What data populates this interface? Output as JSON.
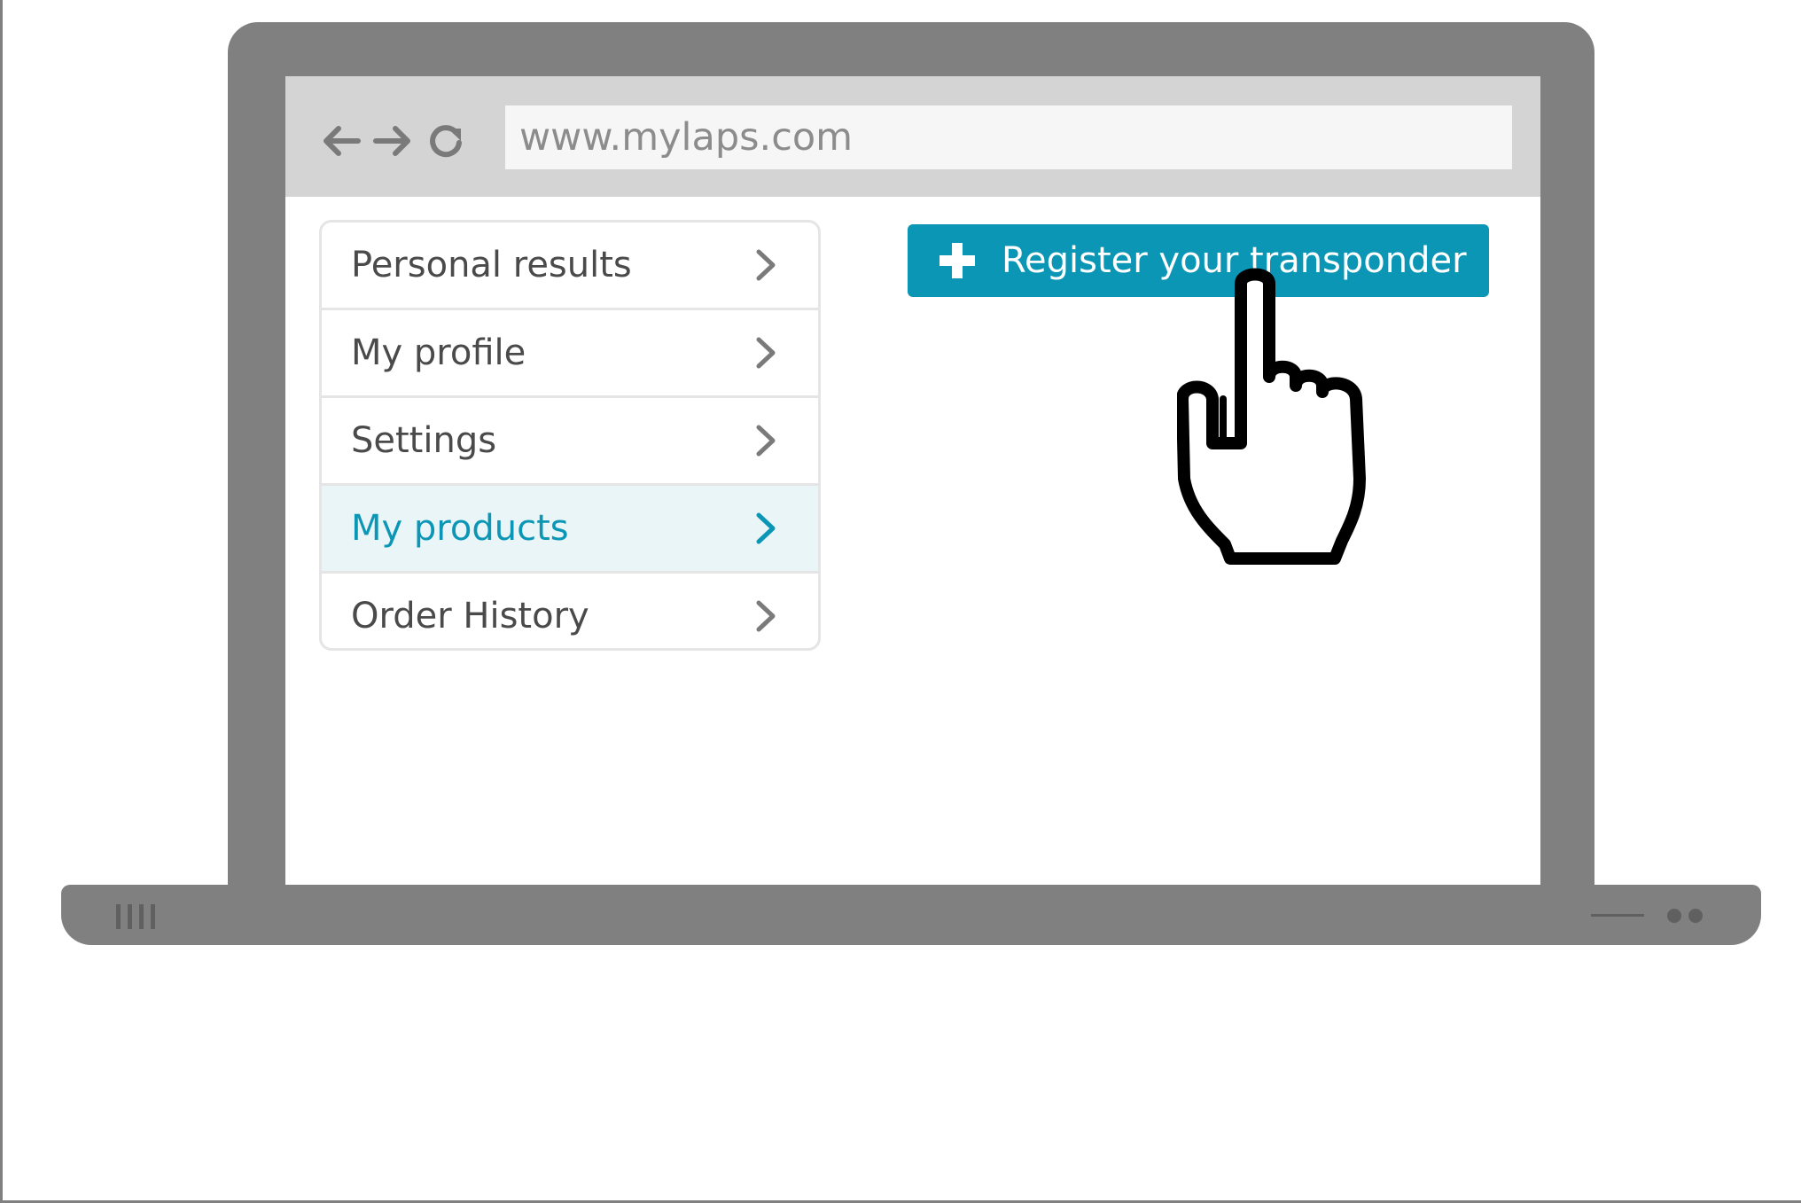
{
  "browser": {
    "url": "www.mylaps.com",
    "nav_icons": [
      "arrow-left-icon",
      "arrow-right-icon",
      "reload-icon"
    ]
  },
  "menu": {
    "items": [
      {
        "label": "Personal results",
        "active": false
      },
      {
        "label": "My profile",
        "active": false
      },
      {
        "label": "Settings",
        "active": false
      },
      {
        "label": "My products",
        "active": true
      },
      {
        "label": "Order History",
        "active": false
      }
    ]
  },
  "register_button": {
    "label": "Register your transponder",
    "icon": "plus-icon"
  },
  "colors": {
    "accent": "#0b96b6",
    "active_bg": "#eaf5f8",
    "laptop": "#808080",
    "browser_bar": "#d4d4d4"
  },
  "cursor": {
    "icon": "hand-pointer-icon"
  }
}
